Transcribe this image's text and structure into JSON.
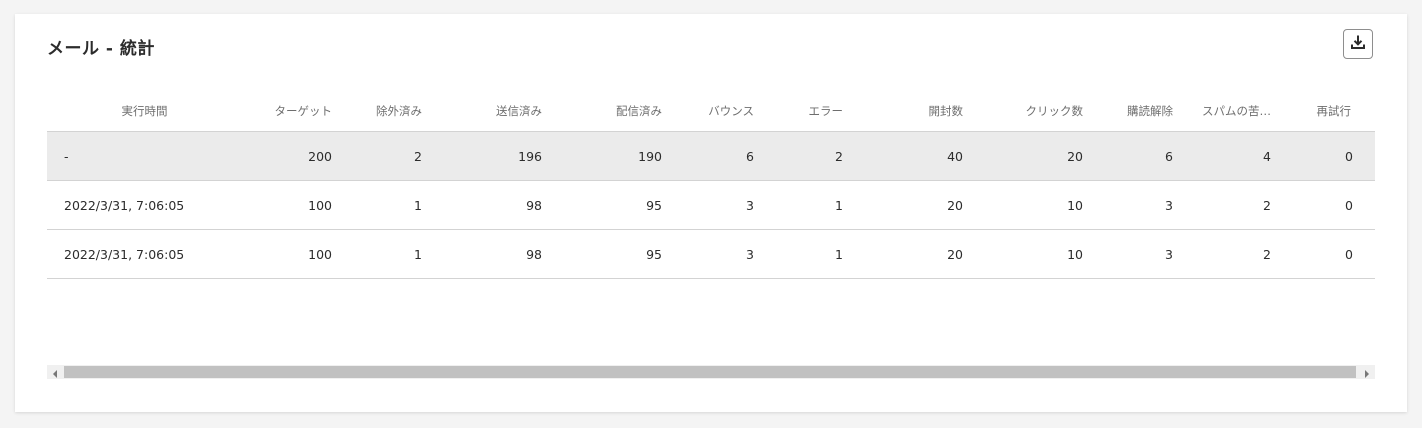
{
  "panel": {
    "title": "メール - 統計"
  },
  "table": {
    "headers": [
      "実行時間",
      "ターゲット",
      "除外済み",
      "送信済み",
      "配信済み",
      "バウンス",
      "エラー",
      "開封数",
      "クリック数",
      "購読解除",
      "スパムの苦…",
      "再試行"
    ],
    "rows": [
      [
        "-",
        "200",
        "2",
        "196",
        "190",
        "6",
        "2",
        "40",
        "20",
        "6",
        "4",
        "0"
      ],
      [
        "2022/3/31, 7:06:05",
        "100",
        "1",
        "98",
        "95",
        "3",
        "1",
        "20",
        "10",
        "3",
        "2",
        "0"
      ],
      [
        "2022/3/31, 7:06:05",
        "100",
        "1",
        "98",
        "95",
        "3",
        "1",
        "20",
        "10",
        "3",
        "2",
        "0"
      ]
    ]
  },
  "icons": {
    "download": "download-icon",
    "scroll_left": "chevron-left-icon",
    "scroll_right": "chevron-right-icon"
  },
  "colors": {
    "total_row_bg": "#ebebeb",
    "header_text": "#6e6e6e",
    "scroll_thumb": "#c1c1c1"
  }
}
